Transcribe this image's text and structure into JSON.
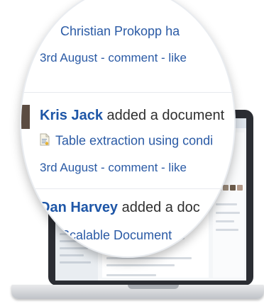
{
  "feed": {
    "item1": {
      "name_fragment": "Christian Prokopp ha",
      "date": "3rd August",
      "comment": "comment",
      "like": "like"
    },
    "item2": {
      "name": "Kris Jack",
      "action": "added a document",
      "document": "Table extraction using condi",
      "date": "3rd August",
      "comment": "comment",
      "like": "like"
    },
    "item3": {
      "name": "Dan Harvey",
      "action": "added a doc",
      "document": "Scalable Document"
    },
    "separator": " - "
  },
  "icons": {
    "document_icon": "document-icon",
    "avatar": "avatar"
  }
}
